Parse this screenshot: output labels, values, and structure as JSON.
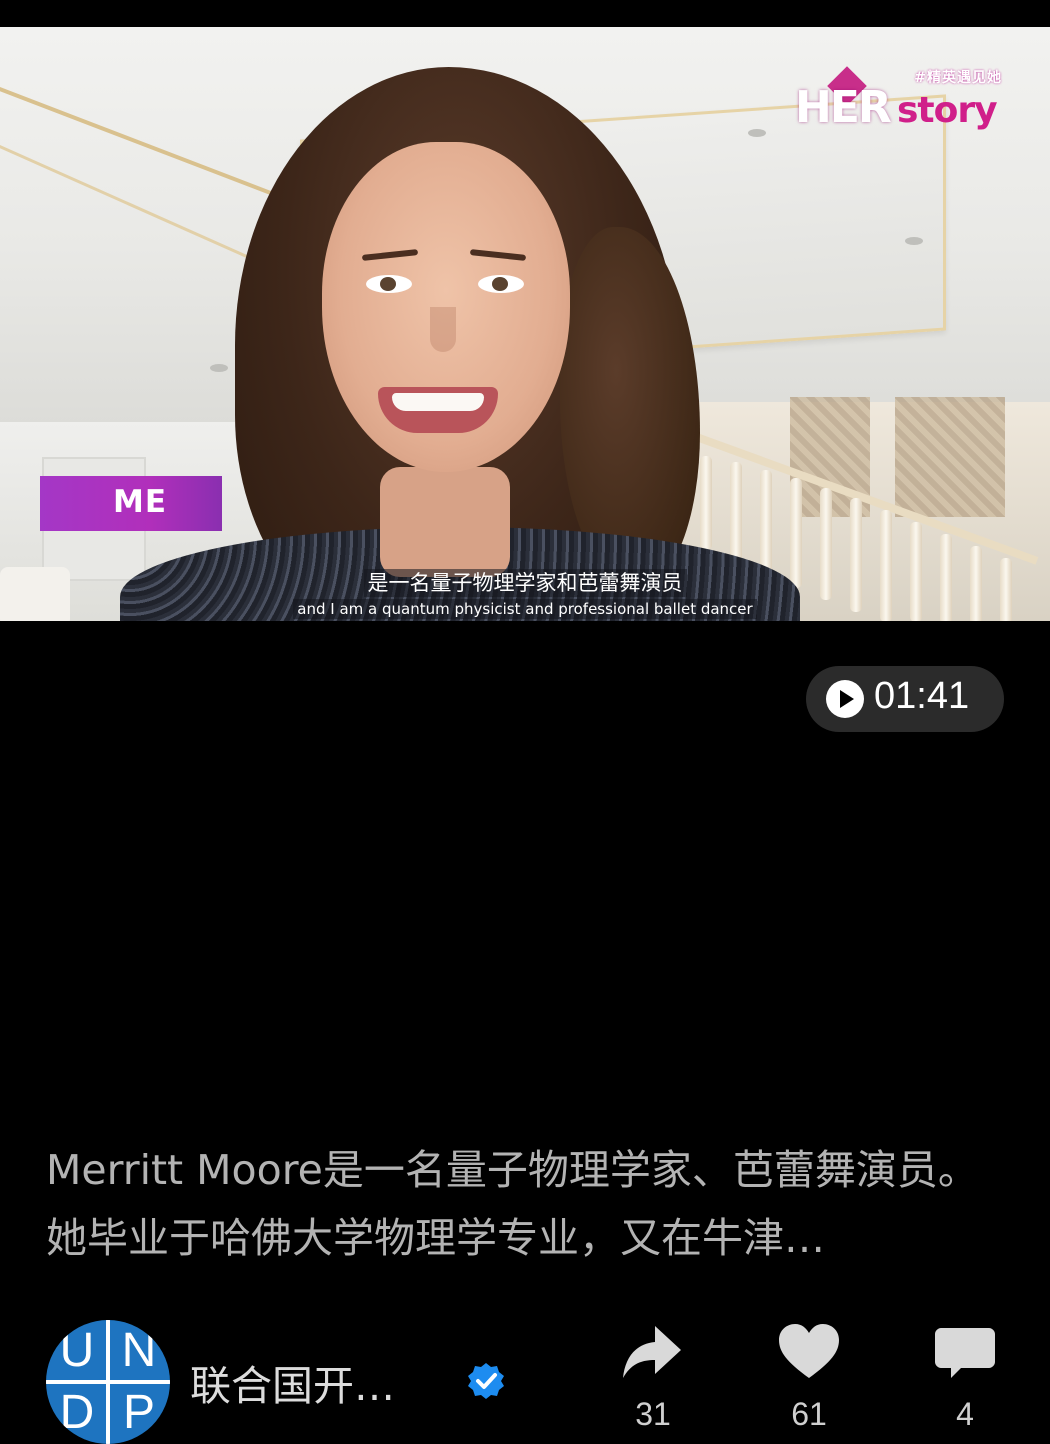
{
  "video": {
    "brand": {
      "hashtag": "#精英遇见她",
      "her": "HER",
      "story": "story"
    },
    "name_tag": "ME",
    "subtitle_zh": "是一名量子物理学家和芭蕾舞演员",
    "subtitle_en": "and I am a quantum physicist and professional ballet dancer",
    "duration": "01:41"
  },
  "post": {
    "description": "Merritt Moore是一名量子物理学家、芭蕾舞演员。她毕业于哈佛大学物理学专业，又在牛津…",
    "author": {
      "name": "联合国开…",
      "avatar_letters": [
        "U",
        "N",
        "D",
        "P"
      ],
      "verified": true
    },
    "stats": {
      "shares": "31",
      "likes": "61",
      "comments": "4"
    }
  },
  "colors": {
    "brand_magenta": "#d01f8a",
    "name_tag_purple": "#a437c6",
    "verified_blue": "#1d8cf0",
    "avatar_blue": "#1e74c0"
  },
  "icons": [
    "play-icon",
    "share-icon",
    "heart-icon",
    "comment-icon",
    "verified-icon"
  ]
}
